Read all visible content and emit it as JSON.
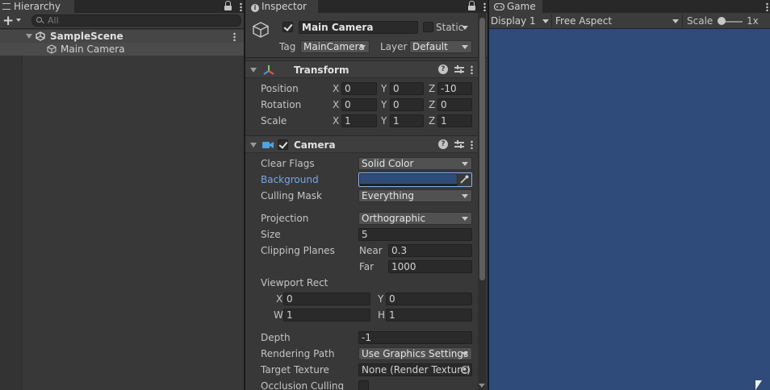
{
  "hierarchy": {
    "tab_label": "Hierarchy",
    "search_placeholder": "All",
    "items": [
      {
        "label": "SampleScene"
      },
      {
        "label": "Main Camera"
      }
    ]
  },
  "inspector": {
    "tab_label": "Inspector",
    "object_name": "Main Camera",
    "static_label": "Static",
    "tag_label": "Tag",
    "tag_value": "MainCamera",
    "layer_label": "Layer",
    "layer_value": "Default",
    "transform": {
      "title": "Transform",
      "rows": [
        {
          "label": "Position",
          "x": "0",
          "y": "0",
          "z": "-10"
        },
        {
          "label": "Rotation",
          "x": "0",
          "y": "0",
          "z": "0"
        },
        {
          "label": "Scale",
          "x": "1",
          "y": "1",
          "z": "1"
        }
      ],
      "axes": [
        "X",
        "Y",
        "Z"
      ]
    },
    "camera": {
      "title": "Camera",
      "clear_flags_label": "Clear Flags",
      "clear_flags_value": "Solid Color",
      "background_label": "Background",
      "background_color": "#2f4b7a",
      "culling_mask_label": "Culling Mask",
      "culling_mask_value": "Everything",
      "projection_label": "Projection",
      "projection_value": "Orthographic",
      "size_label": "Size",
      "size_value": "5",
      "clipping_label": "Clipping Planes",
      "near_label": "Near",
      "near_value": "0.3",
      "far_label": "Far",
      "far_value": "1000",
      "viewport_label": "Viewport Rect",
      "vp_x_label": "X",
      "vp_x": "0",
      "vp_y_label": "Y",
      "vp_y": "0",
      "vp_w_label": "W",
      "vp_w": "1",
      "vp_h_label": "H",
      "vp_h": "1",
      "depth_label": "Depth",
      "depth_value": "-1",
      "rendering_path_label": "Rendering Path",
      "rendering_path_value": "Use Graphics Settings",
      "target_texture_label": "Target Texture",
      "target_texture_value": "None (Render Texture)",
      "occlusion_label": "Occlusion Culling"
    }
  },
  "game": {
    "tab_label": "Game",
    "display_value": "Display 1",
    "aspect_value": "Free Aspect",
    "scale_label": "Scale",
    "scale_value": "1x",
    "viewport_color": "#2f4b7a"
  }
}
